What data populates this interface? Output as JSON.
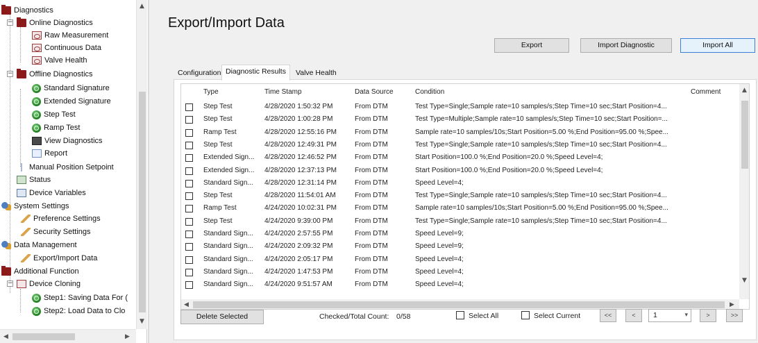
{
  "tree": {
    "items": [
      {
        "label": "Diagnostics",
        "icon": "folder-icon"
      },
      {
        "label": "Online Diagnostics",
        "icon": "folder-icon"
      },
      {
        "label": "Raw Measurement",
        "icon": "measurement-icon"
      },
      {
        "label": "Continuous Data",
        "icon": "continuous-data-icon"
      },
      {
        "label": "Valve Health",
        "icon": "valve-health-icon"
      },
      {
        "label": "Offline Diagnostics",
        "icon": "folder-icon"
      },
      {
        "label": "Standard Signature",
        "icon": "green-gauge-icon"
      },
      {
        "label": "Extended Signature",
        "icon": "green-gauge-icon"
      },
      {
        "label": "Step Test",
        "icon": "green-gauge-icon"
      },
      {
        "label": "Ramp Test",
        "icon": "green-gauge-icon"
      },
      {
        "label": "View Diagnostics",
        "icon": "view-diagnostics-icon"
      },
      {
        "label": "Report",
        "icon": "report-icon"
      },
      {
        "label": "Manual Position Setpoint",
        "icon": "setpoint-icon"
      },
      {
        "label": "Status",
        "icon": "status-icon"
      },
      {
        "label": "Device Variables",
        "icon": "device-variables-icon"
      },
      {
        "label": "System Settings",
        "icon": "gears-icon"
      },
      {
        "label": "Preference Settings",
        "icon": "pencil-icon"
      },
      {
        "label": "Security Settings",
        "icon": "pencil-icon"
      },
      {
        "label": "Data Management",
        "icon": "gears-icon"
      },
      {
        "label": "Export/Import Data",
        "icon": "pencil-icon"
      },
      {
        "label": "Additional Function",
        "icon": "folder-icon"
      },
      {
        "label": "Device Cloning",
        "icon": "clone-icon"
      },
      {
        "label": "Step1: Saving Data For (",
        "icon": "green-gauge-icon"
      },
      {
        "label": "Step2: Load Data to Clo",
        "icon": "green-gauge-icon"
      }
    ]
  },
  "main": {
    "title": "Export/Import Data",
    "buttons": {
      "export": "Export",
      "import_diagnostic": "Import Diagnostic",
      "import_all": "Import All"
    },
    "tabs": [
      {
        "label": "Configuration"
      },
      {
        "label": "Diagnostic Results"
      },
      {
        "label": "Valve Health"
      }
    ],
    "active_tab": "Diagnostic Results",
    "grid": {
      "columns": [
        "Type",
        "Time Stamp",
        "Data Source",
        "Condition",
        "Comment"
      ],
      "rows": [
        {
          "type": "Step Test",
          "time": "4/28/2020 1:50:32 PM",
          "source": "From DTM",
          "condition": "Test Type=Single;Sample rate=10 samples/s;Step Time=10 sec;Start Position=4...",
          "comment": ""
        },
        {
          "type": "Step Test",
          "time": "4/28/2020 1:00:28 PM",
          "source": "From DTM",
          "condition": "Test Type=Multiple;Sample rate=10 samples/s;Step Time=10 sec;Start Position=...",
          "comment": ""
        },
        {
          "type": "Ramp Test",
          "time": "4/28/2020 12:55:16 PM",
          "source": "From DTM",
          "condition": "Sample rate=10 samples/10s;Start Position=5.00 %;End Position=95.00 %;Spee...",
          "comment": ""
        },
        {
          "type": "Step Test",
          "time": "4/28/2020 12:49:31 PM",
          "source": "From DTM",
          "condition": "Test Type=Single;Sample rate=10 samples/s;Step Time=10 sec;Start Position=4...",
          "comment": ""
        },
        {
          "type": "Extended Sign...",
          "time": "4/28/2020 12:46:52 PM",
          "source": "From DTM",
          "condition": "Start Position=100.0 %;End Position=20.0 %;Speed Level=4;",
          "comment": ""
        },
        {
          "type": "Extended Sign...",
          "time": "4/28/2020 12:37:13 PM",
          "source": "From DTM",
          "condition": "Start Position=100.0 %;End Position=20.0 %;Speed Level=4;",
          "comment": ""
        },
        {
          "type": "Standard Sign...",
          "time": "4/28/2020 12:31:14 PM",
          "source": "From DTM",
          "condition": "Speed Level=4;",
          "comment": ""
        },
        {
          "type": "Step Test",
          "time": "4/28/2020 11:54:01 AM",
          "source": "From DTM",
          "condition": "Test Type=Single;Sample rate=10 samples/s;Step Time=10 sec;Start Position=4...",
          "comment": ""
        },
        {
          "type": "Ramp Test",
          "time": "4/24/2020 10:02:31 PM",
          "source": "From DTM",
          "condition": "Sample rate=10 samples/10s;Start Position=5.00 %;End Position=95.00 %;Spee...",
          "comment": ""
        },
        {
          "type": "Step Test",
          "time": "4/24/2020 9:39:00 PM",
          "source": "From DTM",
          "condition": "Test Type=Single;Sample rate=10 samples/s;Step Time=10 sec;Start Position=4...",
          "comment": ""
        },
        {
          "type": "Standard Sign...",
          "time": "4/24/2020 2:57:55 PM",
          "source": "From DTM",
          "condition": "Speed Level=9;",
          "comment": ""
        },
        {
          "type": "Standard Sign...",
          "time": "4/24/2020 2:09:32 PM",
          "source": "From DTM",
          "condition": "Speed Level=9;",
          "comment": ""
        },
        {
          "type": "Standard Sign...",
          "time": "4/24/2020 2:05:17 PM",
          "source": "From DTM",
          "condition": "Speed Level=4;",
          "comment": ""
        },
        {
          "type": "Standard Sign...",
          "time": "4/24/2020 1:47:53 PM",
          "source": "From DTM",
          "condition": "Speed Level=4;",
          "comment": ""
        },
        {
          "type": "Standard Sign...",
          "time": "4/24/2020 9:51:57 AM",
          "source": "From DTM",
          "condition": "Speed Level=4;",
          "comment": ""
        }
      ]
    },
    "footer": {
      "delete_selected": "Delete Selected",
      "count_label": "Checked/Total Count:",
      "count_value": "0/58",
      "select_all": "Select All",
      "select_current": "Select Current",
      "nav_first": "<<",
      "nav_prev": "<",
      "page": "1",
      "nav_next": ">",
      "nav_last": ">>"
    }
  },
  "colors": {
    "window_bg": "#f0f0f0",
    "panel_bg": "#ffffff",
    "primary_button_border": "#3c7fd6",
    "folder_icon": "#8b1a1a",
    "gauge_icon": "#1f7a1f"
  }
}
